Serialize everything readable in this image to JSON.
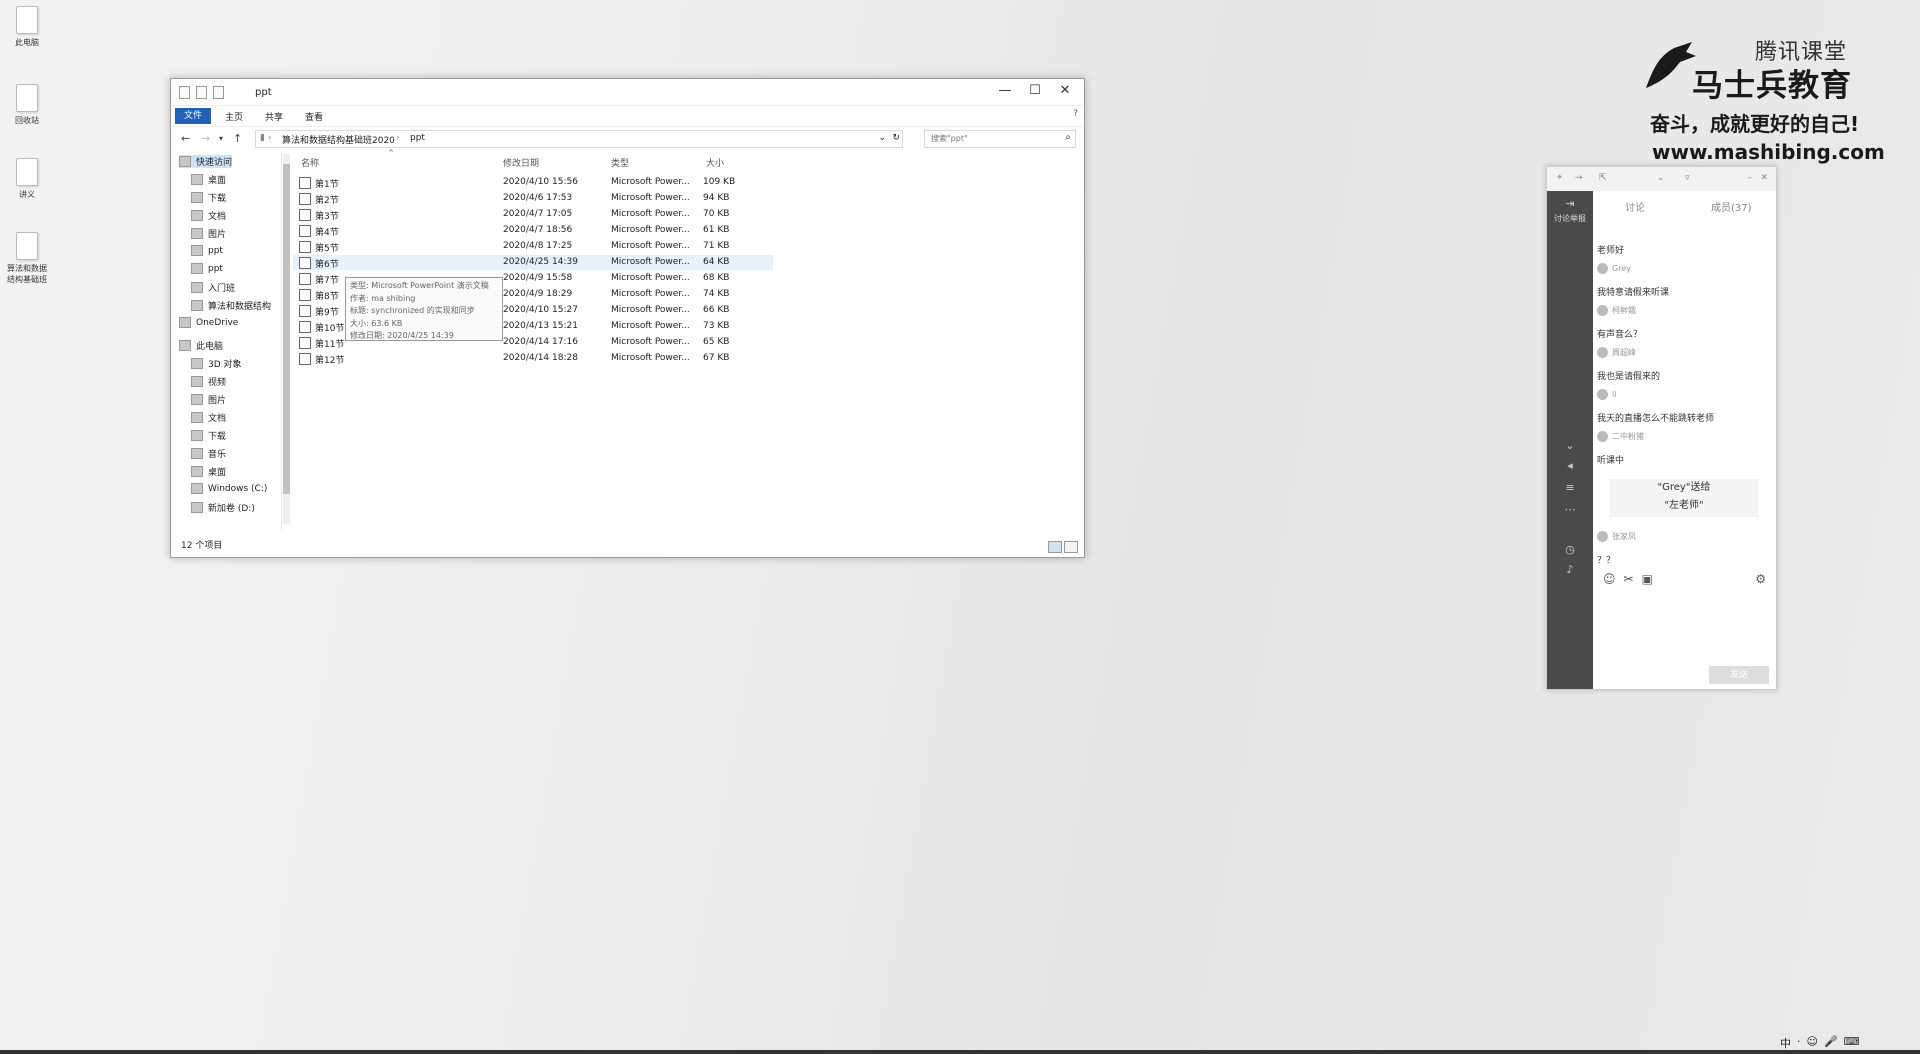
{
  "desktop": {
    "icons": [
      {
        "label": "此电脑"
      },
      {
        "label": "回收站"
      },
      {
        "label": "讲义"
      },
      {
        "label": "算法和数据结构基础班"
      }
    ]
  },
  "brand": {
    "platform": "腾讯课堂",
    "name": "马士兵教育",
    "slogan": "奋斗，成就更好的自己!",
    "url": "www.mashibing.com"
  },
  "explorer": {
    "title": "ppt",
    "window_controls": {
      "minimize": "—",
      "maximize": "☐",
      "close": "✕"
    },
    "ribbon_tabs": [
      "文件",
      "主页",
      "共享",
      "查看"
    ],
    "breadcrumb": [
      "算法和数据结构基础班2020",
      "ppt"
    ],
    "search_placeholder": "搜索\"ppt\"",
    "columns": {
      "name": "名称",
      "date": "修改日期",
      "type": "类型",
      "size": "大小"
    },
    "sidebar": [
      {
        "label": "快速访问"
      },
      {
        "label": "桌面"
      },
      {
        "label": "下载"
      },
      {
        "label": "文档"
      },
      {
        "label": "图片"
      },
      {
        "label": "ppt"
      },
      {
        "label": "ppt"
      },
      {
        "label": "入门班"
      },
      {
        "label": "算法和数据结构"
      },
      {
        "label": "OneDrive"
      },
      {
        "label": "此电脑"
      },
      {
        "label": "3D 对象"
      },
      {
        "label": "视频"
      },
      {
        "label": "图片"
      },
      {
        "label": "文档"
      },
      {
        "label": "下载"
      },
      {
        "label": "音乐"
      },
      {
        "label": "桌面"
      },
      {
        "label": "Windows (C:)"
      },
      {
        "label": "新加卷 (D:)"
      }
    ],
    "files": [
      {
        "name": "第1节",
        "date": "2020/4/10 15:56",
        "type": "Microsoft Power...",
        "size": "109 KB"
      },
      {
        "name": "第2节",
        "date": "2020/4/6 17:53",
        "type": "Microsoft Power...",
        "size": "94 KB"
      },
      {
        "name": "第3节",
        "date": "2020/4/7 17:05",
        "type": "Microsoft Power...",
        "size": "70 KB"
      },
      {
        "name": "第4节",
        "date": "2020/4/7 18:56",
        "type": "Microsoft Power...",
        "size": "61 KB"
      },
      {
        "name": "第5节",
        "date": "2020/4/8 17:25",
        "type": "Microsoft Power...",
        "size": "71 KB"
      },
      {
        "name": "第6节",
        "date": "2020/4/25 14:39",
        "type": "Microsoft Power...",
        "size": "64 KB"
      },
      {
        "name": "第7节",
        "date": "2020/4/9 15:58",
        "type": "Microsoft Power...",
        "size": "68 KB"
      },
      {
        "name": "第8节",
        "date": "2020/4/9 18:29",
        "type": "Microsoft Power...",
        "size": "74 KB"
      },
      {
        "name": "第9节",
        "date": "2020/4/10 15:27",
        "type": "Microsoft Power...",
        "size": "66 KB"
      },
      {
        "name": "第10节",
        "date": "2020/4/13 15:21",
        "type": "Microsoft Power...",
        "size": "73 KB"
      },
      {
        "name": "第11节",
        "date": "2020/4/14 17:16",
        "type": "Microsoft Power...",
        "size": "65 KB"
      },
      {
        "name": "第12节",
        "date": "2020/4/14 18:28",
        "type": "Microsoft Power...",
        "size": "67 KB"
      }
    ],
    "tooltip": [
      "类型: Microsoft PowerPoint 演示文稿",
      "作者: ma shibing",
      "标题: synchronized 的实现和同步",
      "大小: 63.6 KB",
      "修改日期: 2020/4/25 14:39"
    ],
    "status": "12 个项目"
  },
  "chat": {
    "rail_top_label": "讨论举报",
    "tabs": {
      "discuss": "讨论",
      "members": "成员(37)"
    },
    "messages": [
      {
        "user": "",
        "text": "老师好"
      },
      {
        "user": "Grey",
        "text": "我特意请假来听课"
      },
      {
        "user": "柯鲜娥",
        "text": "有声音么？"
      },
      {
        "user": "周超峰",
        "text": "我也是请假来的"
      },
      {
        "user": "li",
        "text": "我天的直播怎么不能跳转老师"
      },
      {
        "user": "二中粉猪",
        "text": "听课中"
      },
      {
        "user": "张家凤",
        "text": "？？"
      }
    ],
    "gift": {
      "line1": "\"Grey\"送给",
      "line2": "\"左老师\""
    },
    "send": "发送"
  },
  "tray": [
    "中",
    "·",
    "☺",
    "🎤",
    "⌨"
  ]
}
